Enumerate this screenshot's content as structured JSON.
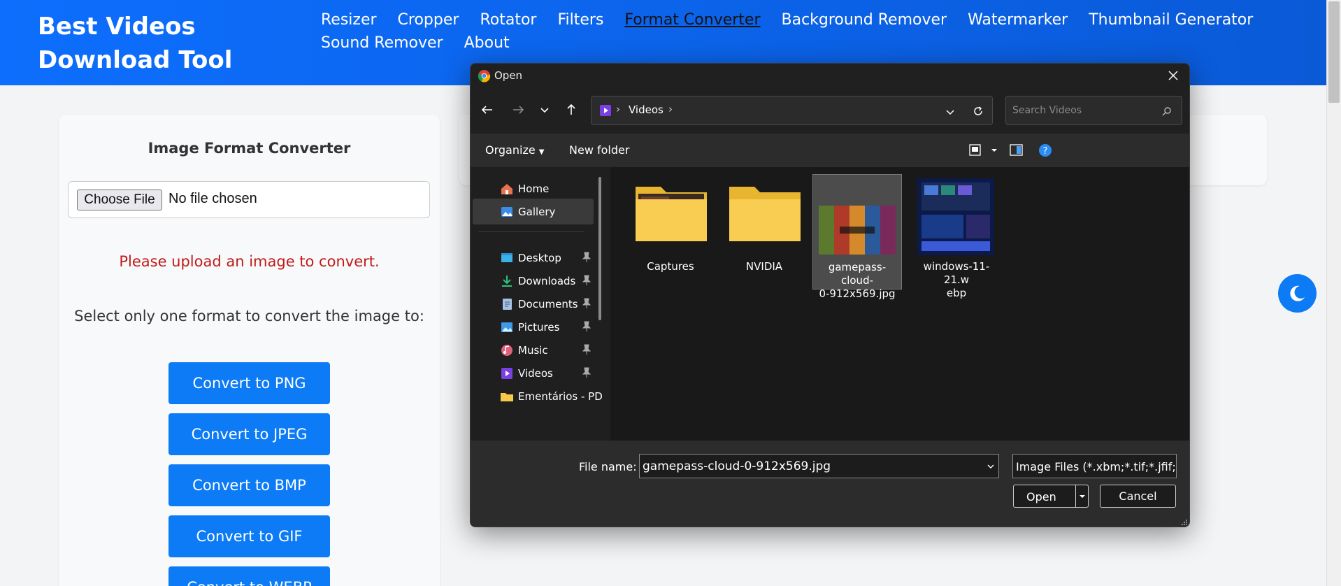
{
  "site": {
    "brand": "Best Videos Download Tool",
    "nav": [
      "Resizer",
      "Cropper",
      "Rotator",
      "Filters",
      "Format Converter",
      "Background Remover",
      "Watermarker",
      "Thumbnail Generator",
      "Sound Remover",
      "About"
    ],
    "active_nav": "Format Converter"
  },
  "converter": {
    "title": "Image Format Converter",
    "choose_file": "Choose File",
    "no_file": "No file chosen",
    "warning": "Please upload an image to convert.",
    "select_text": "Select only one format to convert the image to:",
    "buttons": [
      "Convert to PNG",
      "Convert to JPEG",
      "Convert to BMP",
      "Convert to GIF",
      "Convert to WEBP"
    ]
  },
  "dialog": {
    "title": "Open",
    "breadcrumb": "Videos",
    "search_placeholder": "Search Videos",
    "organize": "Organize",
    "new_folder": "New folder",
    "sidebar": [
      {
        "label": "Home",
        "icon": "home-icon"
      },
      {
        "label": "Gallery",
        "icon": "gallery-icon"
      },
      {
        "label": "Desktop",
        "icon": "desktop-icon"
      },
      {
        "label": "Downloads",
        "icon": "downloads-icon"
      },
      {
        "label": "Documents",
        "icon": "documents-icon"
      },
      {
        "label": "Pictures",
        "icon": "pictures-icon"
      },
      {
        "label": "Music",
        "icon": "music-icon"
      },
      {
        "label": "Videos",
        "icon": "videos-icon"
      },
      {
        "label": "Ementários - PD",
        "icon": "folder-icon"
      }
    ],
    "files": [
      {
        "name": "Captures",
        "type": "folder"
      },
      {
        "name": "NVIDIA",
        "type": "folder"
      },
      {
        "name": "gamepass-cloud-0-912x569.jpg",
        "line1": "gamepass-cloud-",
        "line2": "0-912x569.jpg",
        "type": "image"
      },
      {
        "name": "windows-11-21.webp",
        "line1": "windows-11-21.w",
        "line2": "ebp",
        "type": "image"
      }
    ],
    "file_name_label": "File name:",
    "file_name_value": "gamepass-cloud-0-912x569.jpg",
    "file_type": "Image Files (*.xbm;*.tif;*.jfif;*.pjpeg;*.jpeg;*.svgz;*.jpg;*.webp;*.png;*.bmp;*.pjp;*.ico;*.tiff;*.gif;*.svg;*.jxl;*.avif)",
    "open_label": "Open",
    "cancel_label": "Cancel"
  },
  "colors": {
    "header": "#0d6efd",
    "button": "#0d7bf5",
    "warning": "#c21a1a",
    "dialog_bg": "#202020"
  }
}
